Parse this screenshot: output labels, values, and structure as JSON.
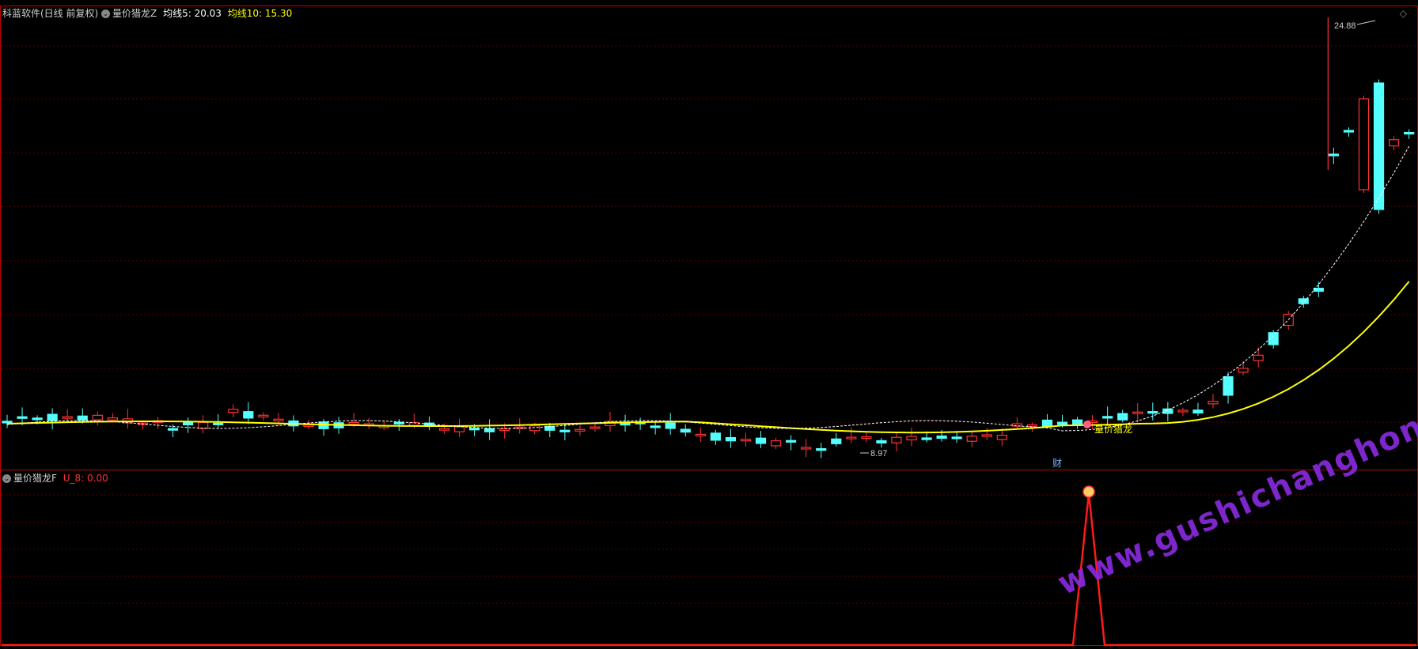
{
  "upper_panel": {
    "software": "科蓝软件(日线 前复权)",
    "indicator_name": "量价猎龙Z",
    "ma5_label": "均线5: 20.03",
    "ma10_label": "均线10: 15.30"
  },
  "lower_panel": {
    "indicator_name": "量价猎龙F",
    "value_label": "U_8: 0.00"
  },
  "annotations": {
    "high_price": "24.88",
    "low_price": "8.97",
    "signal_text": "量价猎龙",
    "fin_marker": "财"
  },
  "watermark": "www.gushichanghong.com",
  "colors": {
    "up": "#ff3232",
    "down": "#54ffff",
    "ma5": "#ffffff",
    "ma10": "#ffff00",
    "grid": "#5a0000",
    "border": "#c00000"
  },
  "icons": {
    "collapse": "collapse-circle-icon",
    "corner": "diamond-icon"
  }
}
